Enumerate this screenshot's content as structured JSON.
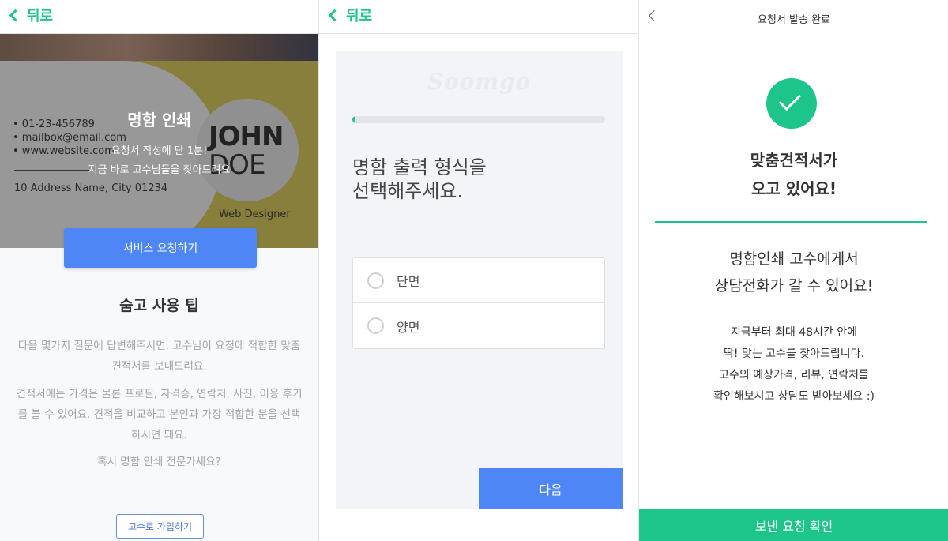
{
  "panel1": {
    "back_label": "뒤로",
    "hero": {
      "contacts": [
        "• 01-23-456789",
        "• mailbox@email.com",
        "• www.website.com"
      ],
      "address": "10 Address Name, City 01234",
      "card_name_line1": "JOHN",
      "card_name_line2": "DOE",
      "job_title": "Web Designer",
      "title": "명함 인쇄",
      "subtitle_line1": "요청서 작성에 단 1분!",
      "subtitle_line2": "지금 바로 고수님들을 찾아드려요"
    },
    "request_button": "서비스 요청하기",
    "tips_title": "숨고 사용 팁",
    "tips_paragraph1": "다음 몇가지 질문에 답변해주시면, 고수님이 요청에 적합한 맞춤 견적서를 보내드려요.",
    "tips_paragraph2": "견적서에는 가격은 물론 프로필, 자격증, 연락처, 사진, 이용 후기를 볼 수 있어요. 견적을 비교하고 본인과 가장 적합한 분을 선택하시면 돼요.",
    "tips_paragraph3": "혹시 명함 인쇄 전문가세요?",
    "join_button": "고수로 가입하기"
  },
  "panel2": {
    "back_label": "뒤로",
    "logo": "Soomgo",
    "progress_percent": 1,
    "question": "명함 출력 형식을\n선택해주세요.",
    "options": [
      "단면",
      "양면"
    ],
    "next_button": "다음"
  },
  "panel3": {
    "header_title": "요청서 발송 완료",
    "done_title": "맞춤견적서가\n오고 있어요!",
    "message": "명함인쇄 고수에게서\n상담전화가 갈 수 있어요!",
    "detail": "지금부터 최대 48시간 안에\n딱! 맞는 고수를 찾아드립니다.\n고수의 예상가격, 리뷰, 연락처를\n확인해보시고 상담도 받아보세요 :)",
    "confirm_button": "보낸 요청 확인"
  },
  "colors": {
    "brand_green": "#1ec58b",
    "primary_blue": "#4f86f5"
  }
}
